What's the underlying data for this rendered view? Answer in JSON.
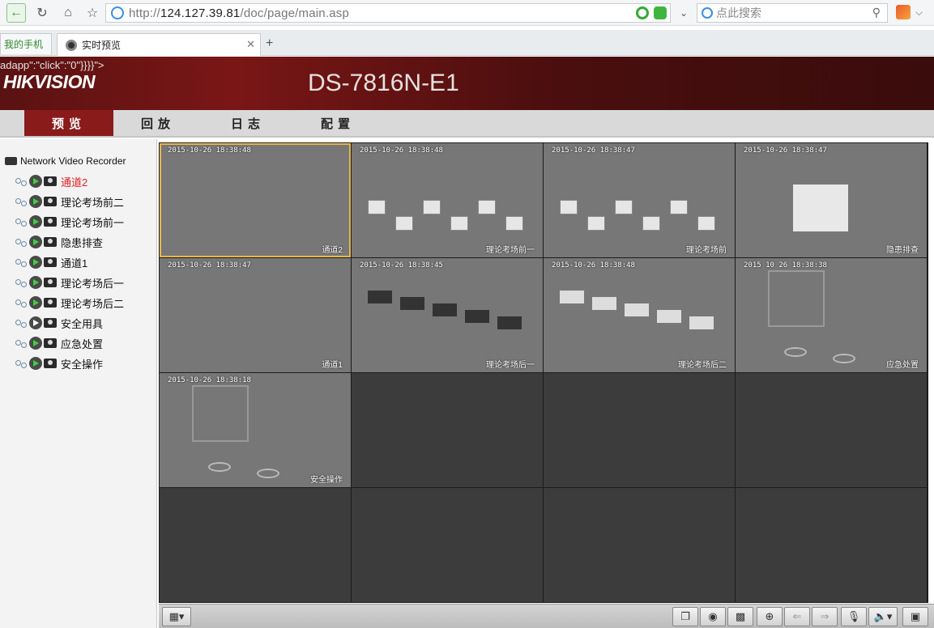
{
  "browser": {
    "url_prefix": "http://",
    "url_host": "124.127.39.81",
    "url_path": "/doc/page/main.asp",
    "search_placeholder": "点此搜索",
    "tabs": [
      {
        "label": "我的手机"
      },
      {
        "label": "实时预览"
      }
    ]
  },
  "header": {
    "stray_text": "adapp\":\"click\":\"0\"}}}}\">",
    "logo": "HIKVISION",
    "model": "DS-7816N-E1"
  },
  "main_nav": [
    "预览",
    "回放",
    "日志",
    "配置"
  ],
  "sidebar": {
    "root": "Network Video Recorder",
    "channels": [
      {
        "label": "通道2",
        "selected": true
      },
      {
        "label": "理论考场前二"
      },
      {
        "label": "理论考场前一"
      },
      {
        "label": "隐患排查"
      },
      {
        "label": "通道1"
      },
      {
        "label": "理论考场后一"
      },
      {
        "label": "理论考场后二"
      },
      {
        "label": "安全用具"
      },
      {
        "label": "应急处置"
      },
      {
        "label": "安全操作"
      }
    ]
  },
  "video_cells": [
    {
      "ts": "2015-10-26 18:38:48",
      "name": "通道2"
    },
    {
      "ts": "2015-10-26 18:38:48",
      "name": "理论考场前一"
    },
    {
      "ts": "2015-10-26 18:38:47",
      "name": "理论考场前"
    },
    {
      "ts": "2015-10-26 18:38:47",
      "name": "隐患排查"
    },
    {
      "ts": "2015-10-26 18:38:47",
      "name": "通道1"
    },
    {
      "ts": "2015-10-26 18:38:45",
      "name": "理论考场后一"
    },
    {
      "ts": "2015-10-26 18:38:48",
      "name": "理论考场后二"
    },
    {
      "ts": "2015 10 26 18:38:38",
      "name": "应急处置"
    },
    {
      "ts": "2015-10-26 18:38:18",
      "name": "安全操作"
    }
  ],
  "colors": {
    "header_red": "#7a1616",
    "nav_active": "#8a1b1b",
    "selected_text": "#e02020",
    "selection_border": "#e6b74a"
  }
}
